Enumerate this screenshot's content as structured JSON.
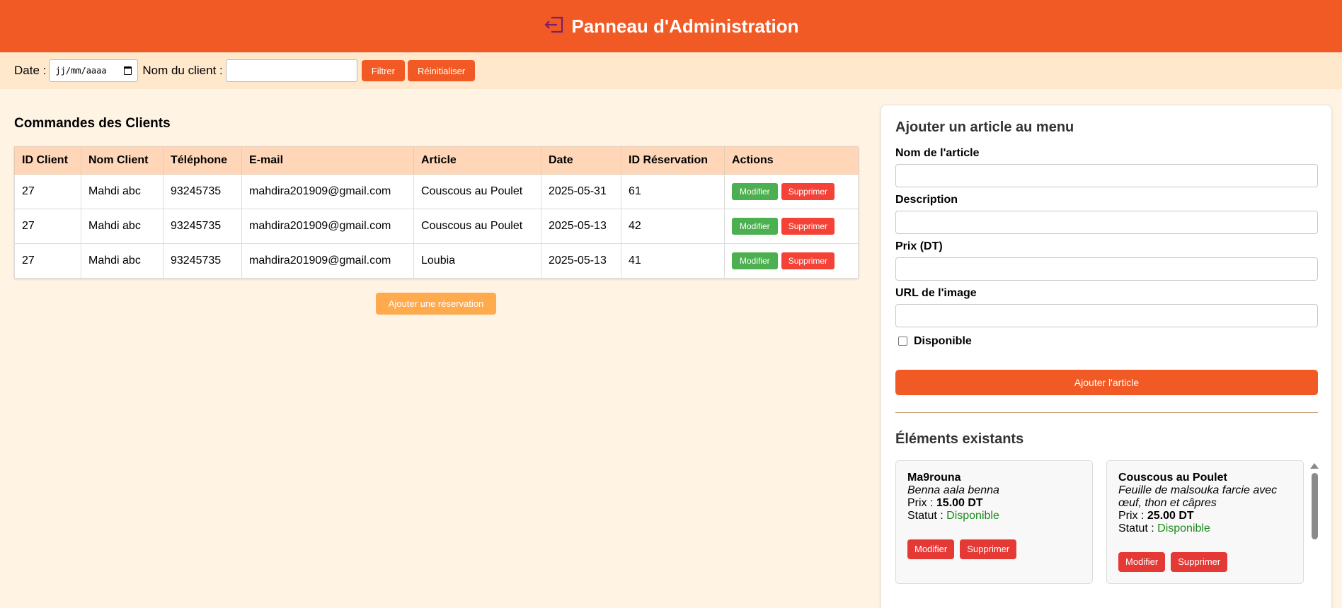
{
  "header": {
    "title": "Panneau d'Administration",
    "icon": "logout-icon"
  },
  "filters": {
    "date_label": "Date :",
    "date_placeholder": "jj/mm/aaaa",
    "client_label": "Nom du client :",
    "client_value": "",
    "filter_button": "Filtrer",
    "reset_button": "Réinitialiser"
  },
  "orders": {
    "title": "Commandes des Clients",
    "columns": [
      "ID Client",
      "Nom Client",
      "Téléphone",
      "E-mail",
      "Article",
      "Date",
      "ID Réservation",
      "Actions"
    ],
    "rows": [
      [
        "27",
        "Mahdi abc",
        "93245735",
        "mahdira201909@gmail.com",
        "Couscous au Poulet",
        "2025-05-31",
        "61"
      ],
      [
        "27",
        "Mahdi abc",
        "93245735",
        "mahdira201909@gmail.com",
        "Couscous au Poulet",
        "2025-05-13",
        "42"
      ],
      [
        "27",
        "Mahdi abc",
        "93245735",
        "mahdira201909@gmail.com",
        "Loubia",
        "2025-05-13",
        "41"
      ]
    ],
    "edit_label": "Modifier",
    "delete_label": "Supprimer",
    "add_reservation": "Ajouter une réservation"
  },
  "menu_form": {
    "title": "Ajouter un article au menu",
    "name_label": "Nom de l'article",
    "description_label": "Description",
    "price_label": "Prix (DT)",
    "image_label": "URL de l'image",
    "available_label": "Disponible",
    "submit": "Ajouter l'article"
  },
  "existing": {
    "title": "Éléments existants",
    "items": [
      {
        "name": "Ma9rouna",
        "description": "Benna aala benna",
        "price_prefix": "Prix : ",
        "price": "15.00 DT",
        "status_prefix": "Statut : ",
        "status": "Disponible"
      },
      {
        "name": "Couscous au Poulet",
        "description": "Feuille de malsouka farcie avec œuf, thon et câpres",
        "price_prefix": "Prix : ",
        "price": "25.00 DT",
        "status_prefix": "Statut : ",
        "status": "Disponible"
      }
    ],
    "edit_label": "Modifier",
    "delete_label": "Supprimer"
  }
}
